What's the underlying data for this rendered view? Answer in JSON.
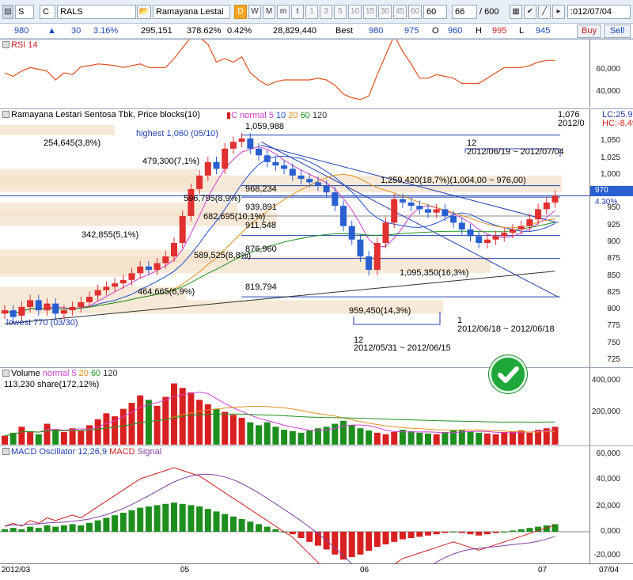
{
  "toolbar": {
    "s_label": "S",
    "c_label": "C",
    "code": "RALS",
    "name": "Ramayana Lestai",
    "periods": [
      "D",
      "W",
      "M",
      "m",
      "t",
      "1",
      "3",
      "5",
      "10",
      "15",
      "30",
      "45",
      "60"
    ],
    "period_value": "60",
    "count": "66",
    "count_total": "/ 600",
    "date": ":012/07/04"
  },
  "quote": {
    "price": "980",
    "change": "30",
    "change_pct": "3.16%",
    "volume": "295,151",
    "volume_pct": "378.62%",
    "turnover_pct": "0.42%",
    "value": "28,829,440",
    "best_label": "Best",
    "best_bid": "980",
    "best_ask": "975",
    "o_label": "O",
    "open": "960",
    "h_label": "H",
    "high": "995",
    "l_label": "L",
    "low": "945",
    "buy_label": "Buy",
    "sell_label": "Sell"
  },
  "rsi_panel": {
    "title": "RSI 14",
    "axis_labels": [
      "60,000",
      "40,000"
    ]
  },
  "price_panel": {
    "title": "Ramayana Lestari Sentosa Tbk, Price blocks(10)",
    "legend_c": "C normal",
    "legend_ma": [
      "5",
      "10",
      "20",
      "60",
      "120"
    ],
    "top_right": [
      "1,076",
      "2012/0"
    ],
    "lc": "LC:25.97",
    "hc": "HC:-8.49",
    "axis_labels": [
      "1,050",
      "1,025",
      "1,000",
      "975",
      "950",
      "925",
      "900",
      "875",
      "850",
      "825",
      "800",
      "775",
      "750",
      "725"
    ],
    "current_price": "970",
    "current_pct": "4.30%",
    "highest": "highest 1,060 (05/10)",
    "lowest": "lowest 770 (03/30)",
    "annotations": [
      "1,059,988",
      "968,234",
      "939,891",
      "911,548",
      "876,960",
      "819,794"
    ],
    "blocks": [
      "254,645(3,8%)",
      "479,300(7,1%)",
      "342,855(5,1%)",
      "596,795(8,9%)",
      "682,695(10,1%)",
      "589,525(8,8%)",
      "464,665(6,9%)",
      "1,259,420(18,7%)(1,004,00 ~ 976,00)",
      "1,095,350(16,3%)",
      "959,450(14,3%)"
    ],
    "ranges": [
      {
        "count": "12",
        "dates": "2012/06/19 ~ 2012/07/04"
      },
      {
        "count": "12",
        "dates": "2012/05/31 ~ 2012/06/15"
      },
      {
        "count": "1",
        "dates": "2012/06/18 ~ 2012/06/18"
      }
    ]
  },
  "volume_panel": {
    "title": "Volume",
    "legend": "normal 5",
    "legend_ma": [
      "20",
      "60",
      "120"
    ],
    "share": "113,230 share(172,12%)",
    "axis_labels": [
      "400,000",
      "200,000"
    ]
  },
  "macd_panel": {
    "title": "MACD Oscillator 12,26,9",
    "macd": "MACD",
    "signal": "Signal",
    "axis_labels": [
      "60,000",
      "40,000",
      "20,000",
      "0,000",
      "-20,000"
    ]
  },
  "x_axis": {
    "labels": [
      "2012/03",
      "05",
      "06",
      "07",
      "07/04"
    ]
  },
  "colors": {
    "up": "#e03030",
    "down": "#2a5fd0",
    "vol_up": "#d82020",
    "vol_down": "#1e8f1e"
  },
  "chart_data": {
    "type": "candlestick",
    "closes": [
      800,
      790,
      805,
      815,
      800,
      810,
      795,
      800,
      805,
      812,
      820,
      830,
      835,
      840,
      845,
      855,
      865,
      860,
      870,
      880,
      900,
      940,
      980,
      1000,
      1020,
      1010,
      1040,
      1050,
      1055,
      1040,
      1030,
      1020,
      1015,
      1010,
      1000,
      995,
      990,
      985,
      975,
      955,
      925,
      905,
      880,
      860,
      900,
      930,
      965,
      960,
      955,
      950,
      945,
      950,
      940,
      930,
      920,
      910,
      900,
      905,
      910,
      915,
      920,
      925,
      935,
      950,
      960,
      970
    ],
    "opens": [
      795,
      800,
      792,
      805,
      815,
      800,
      810,
      795,
      800,
      805,
      812,
      822,
      830,
      835,
      840,
      845,
      855,
      865,
      860,
      870,
      880,
      900,
      940,
      980,
      1000,
      1020,
      1010,
      1040,
      1050,
      1055,
      1040,
      1030,
      1020,
      1015,
      1010,
      1000,
      995,
      990,
      985,
      975,
      955,
      925,
      905,
      880,
      860,
      900,
      930,
      965,
      960,
      955,
      950,
      945,
      950,
      940,
      930,
      920,
      910,
      900,
      905,
      910,
      915,
      920,
      925,
      935,
      950,
      960
    ],
    "volumes": [
      60,
      80,
      120,
      90,
      70,
      140,
      100,
      85,
      110,
      95,
      130,
      170,
      210,
      190,
      240,
      280,
      330,
      300,
      260,
      320,
      410,
      380,
      350,
      300,
      270,
      240,
      220,
      200,
      180,
      150,
      130,
      150,
      120,
      100,
      90,
      80,
      95,
      110,
      120,
      140,
      160,
      130,
      110,
      95,
      80,
      70,
      85,
      100,
      90,
      80,
      75,
      70,
      85,
      95,
      100,
      90,
      80,
      75,
      70,
      85,
      90,
      95,
      80,
      100,
      110,
      120
    ],
    "macd_osc": [
      2,
      3,
      2,
      4,
      3,
      5,
      4,
      5,
      6,
      5,
      7,
      9,
      11,
      13,
      15,
      17,
      19,
      20,
      21,
      22,
      23,
      22,
      21,
      20,
      18,
      16,
      14,
      12,
      10,
      8,
      6,
      4,
      2,
      0,
      -2,
      -5,
      -8,
      -11,
      -14,
      -18,
      -22,
      -20,
      -18,
      -15,
      -12,
      -10,
      -8,
      -6,
      -5,
      -4,
      -3,
      -2,
      -1,
      0,
      -1,
      -2,
      -3,
      -2,
      -1,
      0,
      1,
      2,
      3,
      4,
      5,
      6
    ],
    "ylim": [
      725,
      1075
    ]
  }
}
